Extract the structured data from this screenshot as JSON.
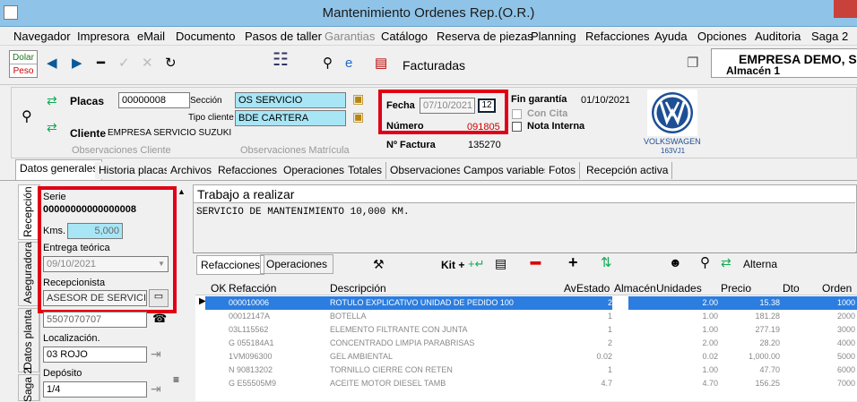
{
  "window": {
    "title": "Mantenimiento Ordenes Rep.(O.R.)"
  },
  "menu": [
    "Navegador",
    "Impresora",
    "eMail",
    "Documento",
    "Pasos de taller",
    "Garantias",
    "Catálogo",
    "Reserva de piezas",
    "Planning",
    "Refacciones",
    "Ayuda",
    "Opciones",
    "Auditoria",
    "Saga 2"
  ],
  "toolbar": {
    "dolar": "Dolar",
    "peso": "Peso",
    "status": "Facturadas"
  },
  "company": {
    "name": "EMPRESA DEMO, S",
    "branch": "Almacén 1"
  },
  "header": {
    "placas_label": "Placas",
    "placas_value": "00000008",
    "seccion_label": "Sección",
    "seccion_value": "OS SERVICIO",
    "tipo_cliente_label": "Tipo cliente",
    "tipo_cliente_value": "BDE CARTERA",
    "cliente_label": "Cliente",
    "cliente_value": "EMPRESA SERVICIO SUZUKI",
    "obs_cliente": "Observaciones  Cliente",
    "obs_matricula": "Observaciones  Matrícula",
    "fecha_label": "Fecha",
    "fecha_value": "07/10/2021",
    "cal_button": "12",
    "numero_label": "Número",
    "numero_value": "091805",
    "factura_label": "Nº Factura",
    "factura_value": "135270",
    "fin_garantia_label": "Fin garantía",
    "fin_garantia_value": "01/10/2021",
    "con_cita": "Con Cita",
    "nota_interna": "Nota Interna",
    "brand": "VOLKSWAGEN",
    "brand_code": "163VJ1"
  },
  "tabs": [
    "Datos generales",
    "Historia placas",
    "Archivos",
    "Refacciones",
    "Operaciones",
    "Totales",
    "Observaciones",
    "Campos variables",
    "Fotos",
    "Recepción activa"
  ],
  "vtabs": [
    "Recepción",
    "Aseguradora",
    "Datos planta",
    "Saga 2"
  ],
  "left": {
    "serie_label": "Serie",
    "serie_value": "00000000000000008",
    "kms_label": "Kms.",
    "kms_value": "5,000",
    "entrega_label": "Entrega teórica",
    "entrega_value": "09/10/2021",
    "recepcionista_label": "Recepcionista",
    "recepcionista_value": "ASESOR DE SERVICIO",
    "phone_value": "5507070707",
    "localizacion_label": "Localización.",
    "localizacion_value": "03 ROJO",
    "deposito_label": "Depósito",
    "deposito_value": "1/4"
  },
  "trabajo": {
    "title": "Trabajo a realizar",
    "text": "SERVICIO DE MANTENIMIENTO 10,000 KM."
  },
  "subtabs": [
    "Refacciones",
    "Operaciones"
  ],
  "subtools": {
    "kit": "Kit +",
    "alterna": "Alterna"
  },
  "grid": {
    "headers": [
      "OK",
      "Refacción",
      "Descripción",
      "Av",
      "Estado",
      "Almacén",
      "Unidades",
      "Precio",
      "Dto",
      "Orden"
    ],
    "rows": [
      {
        "ref": "000010006",
        "desc": "ROTULO EXPLICATIVO UNIDAD DE PEDIDO 100",
        "av": "2",
        "uni": "2.00",
        "precio": "15.38",
        "dto": "",
        "orden": "1000"
      },
      {
        "ref": "00012147A",
        "desc": "BOTELLA",
        "av": "1",
        "uni": "1.00",
        "precio": "181.28",
        "dto": "",
        "orden": "2000"
      },
      {
        "ref": "03L115562",
        "desc": "ELEMENTO FILTRANTE CON JUNTA",
        "av": "1",
        "uni": "1.00",
        "precio": "277.19",
        "dto": "",
        "orden": "3000"
      },
      {
        "ref": "G 055184A1",
        "desc": "CONCENTRADO LIMPIA PARABRISAS",
        "av": "2",
        "uni": "2.00",
        "precio": "28.20",
        "dto": "",
        "orden": "4000"
      },
      {
        "ref": "1VM096300",
        "desc": "GEL AMBIENTAL",
        "av": "0.02",
        "uni": "0.02",
        "precio": "1,000.00",
        "dto": "",
        "orden": "5000"
      },
      {
        "ref": "N  90813202",
        "desc": "TORNILLO CIERRE CON RETEN",
        "av": "1",
        "uni": "1.00",
        "precio": "47.70",
        "dto": "",
        "orden": "6000"
      },
      {
        "ref": "G E55505M9",
        "desc": "ACEITE MOTOR DIESEL  TAMB",
        "av": "4.7",
        "uni": "4.70",
        "precio": "156.25",
        "dto": "",
        "orden": "7000"
      }
    ]
  }
}
